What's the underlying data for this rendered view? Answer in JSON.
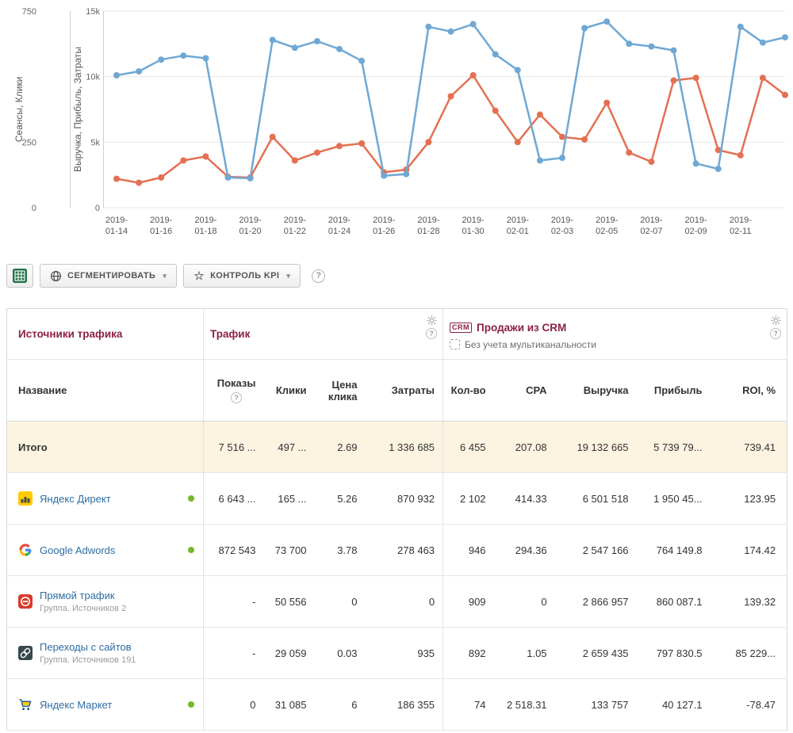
{
  "chart_data": {
    "type": "line",
    "x": [
      "2019-01-14",
      "2019-01-15",
      "2019-01-16",
      "2019-01-17",
      "2019-01-18",
      "2019-01-19",
      "2019-01-20",
      "2019-01-21",
      "2019-01-22",
      "2019-01-23",
      "2019-01-24",
      "2019-01-25",
      "2019-01-26",
      "2019-01-27",
      "2019-01-28",
      "2019-01-29",
      "2019-01-30",
      "2019-01-31",
      "2019-02-01",
      "2019-02-02",
      "2019-02-03",
      "2019-02-04",
      "2019-02-05",
      "2019-02-06",
      "2019-02-07",
      "2019-02-08",
      "2019-02-09",
      "2019-02-10",
      "2019-02-11",
      "2019-02-12",
      "2019-02-13"
    ],
    "left_axis": {
      "title": "Сеансы, Клики",
      "min": 0,
      "max": 750,
      "ticks": [
        {
          "value": 750,
          "label": "750"
        },
        {
          "value": 250,
          "label": "250"
        },
        {
          "value": 0,
          "label": "0"
        }
      ]
    },
    "right_axis": {
      "title": "Выручка, Прибыль, Затраты",
      "min": 0,
      "max": 15000,
      "ticks": [
        {
          "value": 15000,
          "label": "15k"
        },
        {
          "value": 10000,
          "label": "10k"
        },
        {
          "value": 5000,
          "label": "5k"
        },
        {
          "value": 0,
          "label": "0"
        }
      ]
    },
    "series": [
      {
        "name": "Выручка, Прибыль, Затраты",
        "axis": "right",
        "color": "#e47052",
        "values": [
          2200,
          1900,
          2300,
          3600,
          3900,
          2350,
          2300,
          5400,
          3600,
          4200,
          4700,
          4900,
          2700,
          2900,
          5000,
          8500,
          10100,
          7400,
          5000,
          7100,
          5400,
          5200,
          8000,
          4200,
          3500,
          9700,
          9900,
          4400,
          4000,
          9900,
          8600
        ]
      },
      {
        "name": "Сеансы, Клики",
        "axis": "left",
        "color": "#6fa8d4",
        "values": [
          505,
          520,
          565,
          580,
          570,
          115,
          112,
          640,
          610,
          635,
          605,
          560,
          122,
          128,
          690,
          672,
          700,
          585,
          525,
          180,
          190,
          685,
          710,
          625,
          615,
          600,
          168,
          148,
          690,
          630,
          650
        ]
      }
    ],
    "grid": "horizontal",
    "legend": "none"
  },
  "toolbar": {
    "segment_label": "СЕГМЕНТИРОВАТЬ",
    "kpi_label": "КОНТРОЛЬ KPI",
    "help_label": "?"
  },
  "table": {
    "sections": {
      "sources": {
        "title": "Источники трафика"
      },
      "traffic": {
        "title": "Трафик"
      },
      "crm": {
        "badge": "CRM",
        "title": "Продажи из CRM",
        "subtitle": "Без учета мультиканальности"
      }
    },
    "columns": {
      "name": "Название",
      "impressions": "Показы",
      "clicks": "Клики",
      "cpc": "Цена клика",
      "costs": "Затраты",
      "count": "Кол-во",
      "cpa": "CPA",
      "revenue": "Выручка",
      "profit": "Прибыль",
      "roi": "ROI, %"
    },
    "total": {
      "label": "Итого",
      "values": [
        "7 516 ...",
        "497 ...",
        "2.69",
        "1 336 685",
        "6 455",
        "207.08",
        "19 132 665",
        "5 739 79...",
        "739.41"
      ]
    },
    "rows": [
      {
        "name": "Яндекс Директ",
        "icon": "yandex-direct",
        "status_dot": true,
        "values": [
          "6 643 ...",
          "165 ...",
          "5.26",
          "870 932",
          "2 102",
          "414.33",
          "6 501 518",
          "1 950 45...",
          "123.95"
        ]
      },
      {
        "name": "Google Adwords",
        "icon": "google-adwords",
        "status_dot": true,
        "values": [
          "872 543",
          "73 700",
          "3.78",
          "278 463",
          "946",
          "294.36",
          "2 547 166",
          "764 149.8",
          "174.42"
        ]
      },
      {
        "name": "Прямой трафик",
        "subtitle": "Группа. Источников 2",
        "icon": "direct-traffic",
        "status_dot": false,
        "values": [
          "-",
          "50 556",
          "0",
          "0",
          "909",
          "0",
          "2 866 957",
          "860 087.1",
          "139.32"
        ]
      },
      {
        "name": "Переходы с сайтов",
        "subtitle": "Группа. Источников 191",
        "icon": "site-referrals",
        "status_dot": false,
        "values": [
          "-",
          "29 059",
          "0.03",
          "935",
          "892",
          "1.05",
          "2 659 435",
          "797 830.5",
          "85 229..."
        ]
      },
      {
        "name": "Яндекс Маркет",
        "icon": "yandex-market",
        "status_dot": true,
        "values": [
          "0",
          "31 085",
          "6",
          "186 355",
          "74",
          "2 518.31",
          "133 757",
          "40 127.1",
          "-78.47"
        ]
      }
    ]
  }
}
